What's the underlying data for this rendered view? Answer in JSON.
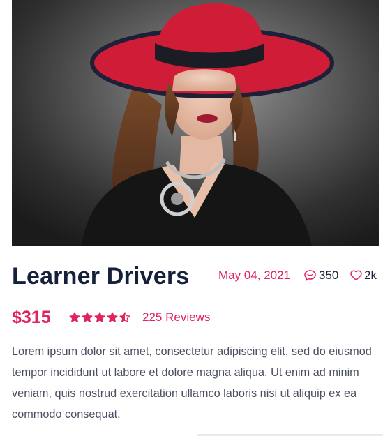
{
  "post": {
    "title": "Learner Drivers",
    "date": "May 04, 2021",
    "comments": "350",
    "likes": "2k",
    "price": "$315",
    "rating": 4.5,
    "rating_max": 5,
    "reviews": "225 Reviews",
    "description": "Lorem ipsum dolor sit amet, consectetur adipiscing elit, sed do eiusmod tempor incididunt ut labore et dolore magna aliqua. Ut enim ad minim veniam, quis nostrud exercitation ullamco laboris nisi ut aliquip ex ea commodo consequat."
  },
  "icons": {
    "comments": "comment-icon",
    "likes": "heart-icon",
    "rating": "star-icon"
  },
  "colors": {
    "accent": "#e0245e",
    "title": "#15203a",
    "body_text": "#4a5061"
  }
}
